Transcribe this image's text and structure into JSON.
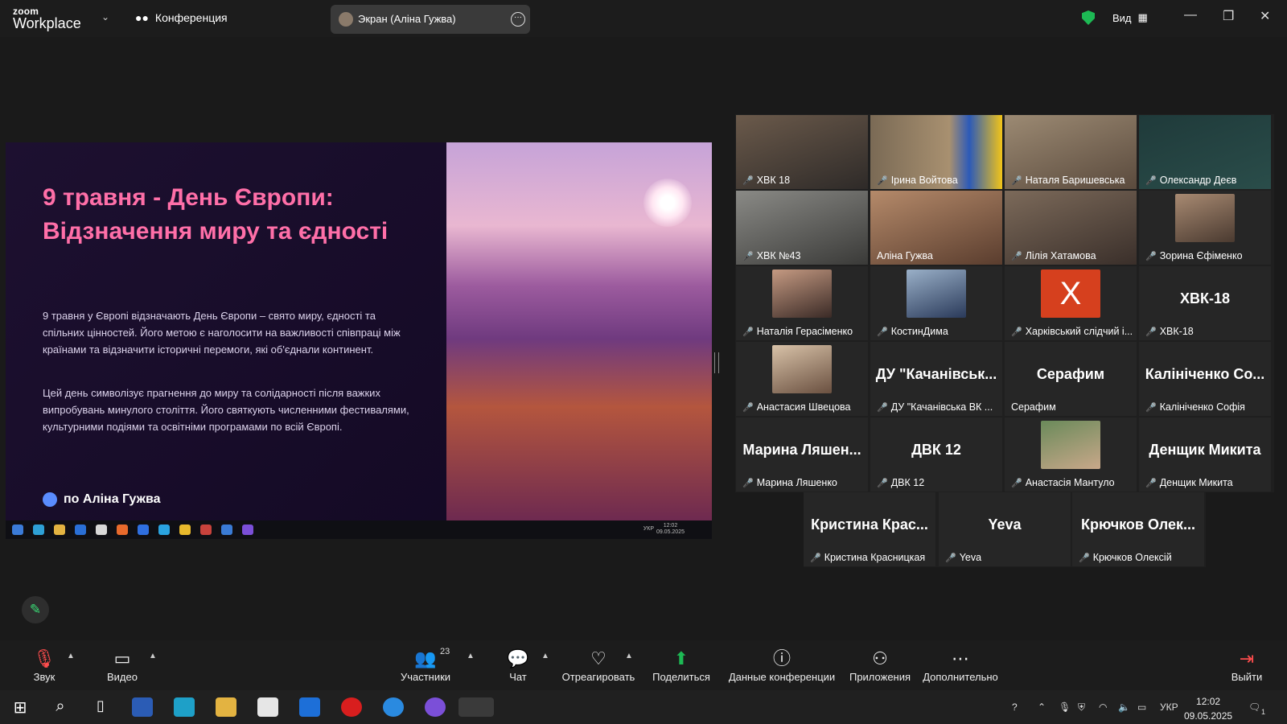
{
  "header": {
    "logo_top": "zoom",
    "logo_bottom": "Workplace",
    "meeting_label": "Конференция",
    "screen_share_label": "Экран (Аліна Гужва)",
    "view_label": "Вид"
  },
  "slide": {
    "title": "9 травня - День Європи: Відзначення миру та єдності",
    "paragraph1": "9 травня у Європі відзначають День Європи – свято миру, єдності та спільних цінностей. Його метою є наголосити на важливості співпраці між країнами та відзначити історичні перемоги, які об'єднали континент.",
    "paragraph2": "Цей день символізує прагнення до миру та солідарності після важких випробувань минулого століття. Його святкують численними фестивалями, культурними подіями та освітніми програмами по всій Європі.",
    "byline": "по Аліна Гужва",
    "mini_taskbar": {
      "lang": "УКР",
      "time": "12:02",
      "date": "09.05.2025"
    }
  },
  "participants": [
    {
      "name": "ХВК 18",
      "type": "video",
      "muted": true
    },
    {
      "name": "Ірина Войтова",
      "type": "video",
      "muted": true
    },
    {
      "name": "Наталя Баришевська",
      "type": "video",
      "muted": true
    },
    {
      "name": "Олександр Деєв",
      "type": "video",
      "muted": true
    },
    {
      "name": "ХВК №43",
      "type": "video",
      "muted": true
    },
    {
      "name": "Аліна Гужва",
      "type": "video",
      "muted": false,
      "active": true
    },
    {
      "name": "Лілія Хатамова",
      "type": "video",
      "muted": true
    },
    {
      "name": "Зорина Єфіменко",
      "type": "avatar",
      "muted": true
    },
    {
      "name": "Наталія Герасіменко",
      "type": "avatar",
      "muted": true
    },
    {
      "name": "КостинДима",
      "type": "avatar",
      "muted": true
    },
    {
      "name": "Харківський слідчий і...",
      "type": "letter",
      "letter": "X",
      "muted": true
    },
    {
      "name": "ХВК-18",
      "type": "text",
      "display": "ХВК-18",
      "muted": true
    },
    {
      "name": "Анастасия Швецова",
      "type": "avatar",
      "muted": true
    },
    {
      "name": "ДУ \"Качанівська ВК ...",
      "type": "text",
      "display": "ДУ \"Качанівськ...",
      "muted": true
    },
    {
      "name": "Серафим",
      "type": "text",
      "display": "Серафим",
      "muted": false
    },
    {
      "name": "Калініченко Софія",
      "type": "text",
      "display": "Калініченко Со...",
      "muted": true
    },
    {
      "name": "Марина Ляшенко",
      "type": "text",
      "display": "Марина Ляшен...",
      "muted": true
    },
    {
      "name": "ДВК 12",
      "type": "text",
      "display": "ДВК 12",
      "muted": true
    },
    {
      "name": "Анастасія Мантуло",
      "type": "avatar",
      "muted": true
    },
    {
      "name": "Денщик Микита",
      "type": "text",
      "display": "Денщик Микита",
      "muted": true
    },
    {
      "name": "Кристина Красницкая",
      "type": "text",
      "display": "Кристина Крас...",
      "muted": true
    },
    {
      "name": "Yeva",
      "type": "text",
      "display": "Yeva",
      "muted": true
    },
    {
      "name": "Крючков Олексій",
      "type": "text",
      "display": "Крючков Олек...",
      "muted": true
    }
  ],
  "toolbar": {
    "audio": "Звук",
    "video": "Видео",
    "participants": "Участники",
    "participants_count": "23",
    "chat": "Чат",
    "react": "Отреагировать",
    "share": "Поделиться",
    "info": "Данные конференции",
    "apps": "Приложения",
    "more": "Дополнительно",
    "leave": "Выйти"
  },
  "taskbar": {
    "lang": "УКР",
    "time": "12:02",
    "date": "09.05.2025",
    "notifications": "1"
  },
  "colors": {
    "accent_green": "#33e07a",
    "title_pink": "#ff6fa8",
    "muted_red": "#ff4d4d",
    "share_green": "#1db954"
  }
}
